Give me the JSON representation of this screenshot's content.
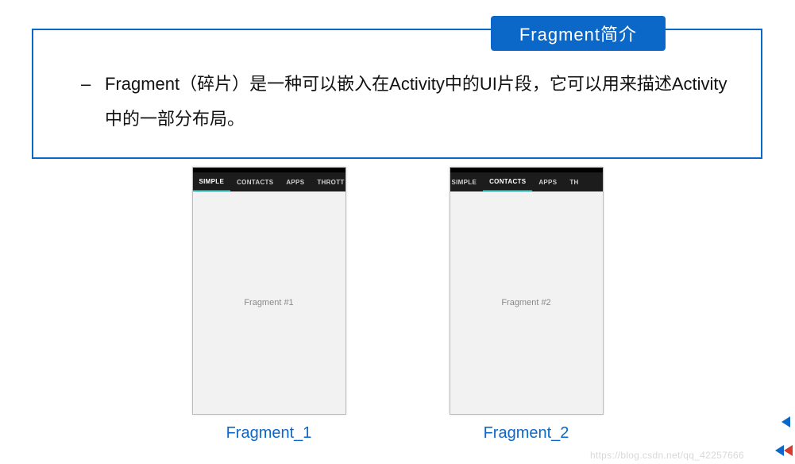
{
  "title": "Fragment简介",
  "description": {
    "dash": "–",
    "text": "Fragment（碎片）是一种可以嵌入在Activity中的UI片段，它可以用来描述Activity中的一部分布局。"
  },
  "phones": {
    "left": {
      "tabs": {
        "t0": "SIMPLE",
        "t1": "CONTACTS",
        "t2": "APPS",
        "t3": "THROTT"
      },
      "active_index": 0,
      "body_text": "Fragment #1",
      "caption": "Fragment_1"
    },
    "right": {
      "tabs": {
        "t0": "SIMPLE",
        "t1": "CONTACTS",
        "t2": "APPS",
        "t3": "TH"
      },
      "active_index": 1,
      "body_text": "Fragment #2",
      "caption": "Fragment_2"
    }
  },
  "watermark": "https://blog.csdn.net/qq_42257666"
}
